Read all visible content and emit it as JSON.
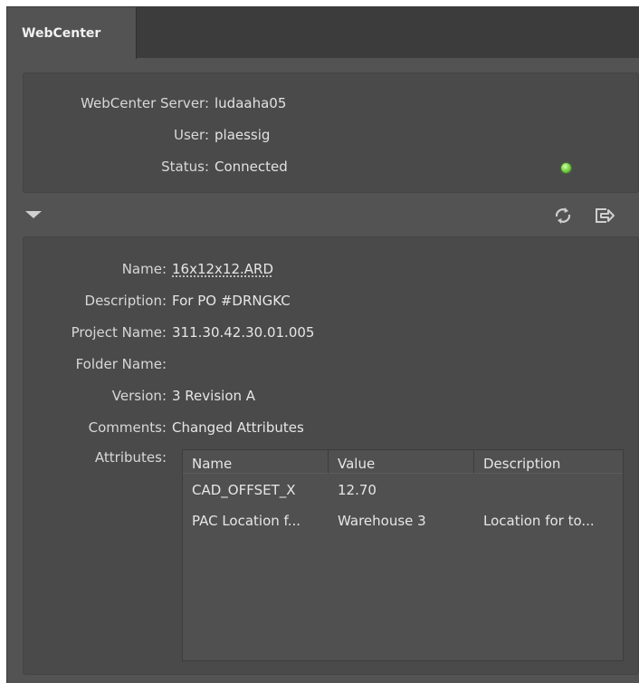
{
  "tab": {
    "label": "WebCenter"
  },
  "server": {
    "server_label": "WebCenter Server:",
    "server_value": "ludaaha05",
    "user_label": "User:",
    "user_value": "plaessig",
    "status_label": "Status:",
    "status_value": "Connected",
    "status_color": "#7fd84a"
  },
  "toolbar": {
    "expand_icon": "disclosure-triangle",
    "refresh_icon": "refresh",
    "open_icon": "open-external"
  },
  "details": {
    "name_label": "Name:",
    "name_value": "16x12x12.ARD",
    "description_label": "Description:",
    "description_value": "For PO #DRNGKC",
    "project_label": "Project Name:",
    "project_value": "311.30.42.30.01.005",
    "folder_label": "Folder Name:",
    "folder_value": "",
    "version_label": "Version:",
    "version_value": "3 Revision A",
    "comments_label": "Comments:",
    "comments_value": "Changed Attributes",
    "attributes_label": "Attributes:"
  },
  "attributes": {
    "columns": [
      "Name",
      "Value",
      "Description"
    ],
    "rows": [
      [
        "CAD_OFFSET_X",
        "12.70",
        ""
      ],
      [
        "PAC Location f...",
        "Warehouse 3",
        "Location for to..."
      ]
    ]
  }
}
